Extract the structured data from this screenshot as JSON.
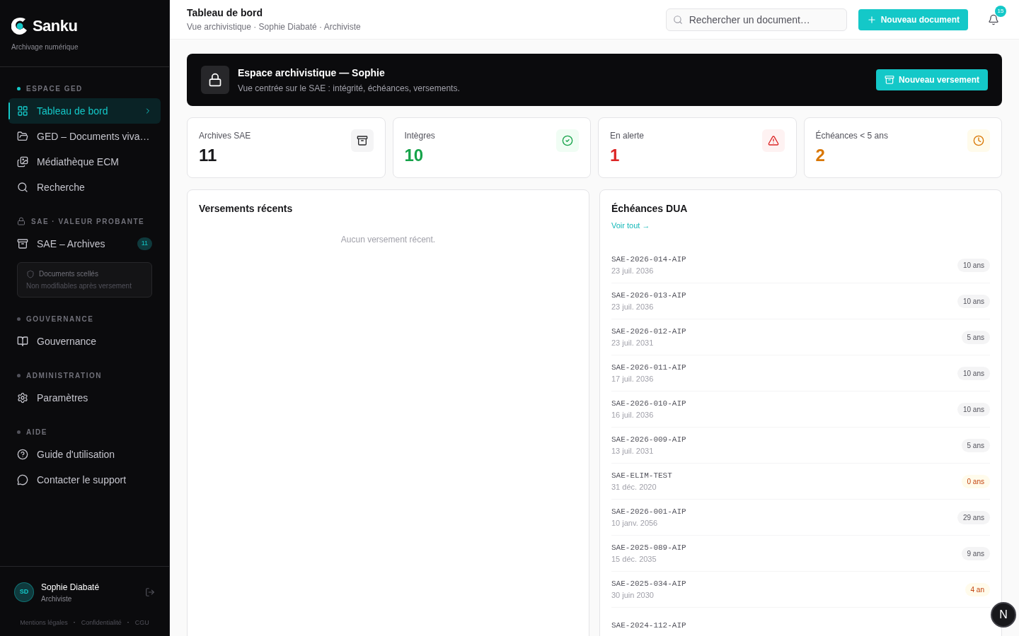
{
  "brand": {
    "name": "Sanku",
    "tagline": "Archivage numérique"
  },
  "sidebar": {
    "sections": [
      {
        "title": "ESPACE GED",
        "kind": "dot",
        "items": [
          {
            "label": "Tableau de bord",
            "selected": true
          },
          {
            "label": "GED – Documents viva…",
            "selected": false
          },
          {
            "label": "Médiathèque ECM",
            "selected": false
          },
          {
            "label": "Recherche",
            "selected": false
          }
        ]
      },
      {
        "title": "SAE · VALEUR PROBANTE",
        "kind": "lock",
        "items": [
          {
            "label": "SAE – Archives",
            "selected": false,
            "badge": "11"
          }
        ],
        "note": {
          "title": "Documents scellés",
          "text": "Non modifiables après versement"
        }
      },
      {
        "title": "GOUVERNANCE",
        "kind": "dot",
        "items": [
          {
            "label": "Gouvernance",
            "selected": false
          }
        ]
      },
      {
        "title": "ADMINISTRATION",
        "kind": "dot",
        "items": [
          {
            "label": "Paramètres",
            "selected": false
          }
        ]
      },
      {
        "title": "AIDE",
        "kind": "dot",
        "items": [
          {
            "label": "Guide d'utilisation",
            "selected": false
          },
          {
            "label": "Contacter le support",
            "selected": false
          }
        ]
      }
    ],
    "user": {
      "initials": "SD",
      "name": "Sophie Diabaté",
      "role": "Archiviste"
    },
    "footer_links": [
      "Mentions légales",
      "Confidentialité",
      "CGU"
    ],
    "footer_separator": "·"
  },
  "header": {
    "title": "Tableau de bord",
    "subtitle": "Vue archivistique · Sophie Diabaté · Archiviste",
    "search": {
      "placeholder": "Rechercher un document…"
    },
    "new_button": "Nouveau document",
    "notifications": "15"
  },
  "banner": {
    "title": "Espace archivistique — Sophie",
    "text": "Vue centrée sur le SAE : intégrité, échéances, versements.",
    "button": "Nouveau versement"
  },
  "stats": [
    {
      "label": "Archives SAE",
      "value": "11",
      "kind": "neutral"
    },
    {
      "label": "Intègres",
      "value": "10",
      "kind": "success"
    },
    {
      "label": "En alerte",
      "value": "1",
      "kind": "danger"
    },
    {
      "label": "Échéances < 5 ans",
      "value": "2",
      "kind": "warning"
    }
  ],
  "recent": {
    "title": "Versements récents",
    "empty": "Aucun versement récent."
  },
  "deadlines": {
    "title": "Échéances DUA",
    "link": "Voir tout →",
    "rows": [
      {
        "id": "SAE-2026-014-AIP",
        "date": "23 juil. 2036",
        "badge": "10 ans",
        "kind": "normal"
      },
      {
        "id": "SAE-2026-013-AIP",
        "date": "23 juil. 2036",
        "badge": "10 ans",
        "kind": "normal"
      },
      {
        "id": "SAE-2026-012-AIP",
        "date": "23 juil. 2031",
        "badge": "5 ans",
        "kind": "normal"
      },
      {
        "id": "SAE-2026-011-AIP",
        "date": "17 juil. 2036",
        "badge": "10 ans",
        "kind": "normal"
      },
      {
        "id": "SAE-2026-010-AIP",
        "date": "16 juil. 2036",
        "badge": "10 ans",
        "kind": "normal"
      },
      {
        "id": "SAE-2026-009-AIP",
        "date": "13 juil. 2031",
        "badge": "5 ans",
        "kind": "normal"
      },
      {
        "id": "SAE-ELIM-TEST",
        "date": "31 déc. 2020",
        "badge": "0 ans",
        "kind": "warning"
      },
      {
        "id": "SAE-2026-001-AIP",
        "date": "10 janv. 2056",
        "badge": "29 ans",
        "kind": "normal"
      },
      {
        "id": "SAE-2025-089-AIP",
        "date": "15 déc. 2035",
        "badge": "9 ans",
        "kind": "normal"
      },
      {
        "id": "SAE-2025-034-AIP",
        "date": "30 juin 2030",
        "badge": "4 an",
        "kind": "warning"
      },
      {
        "id": "SAE-2024-112-AIP"
      }
    ]
  },
  "dev_badge": "N"
}
